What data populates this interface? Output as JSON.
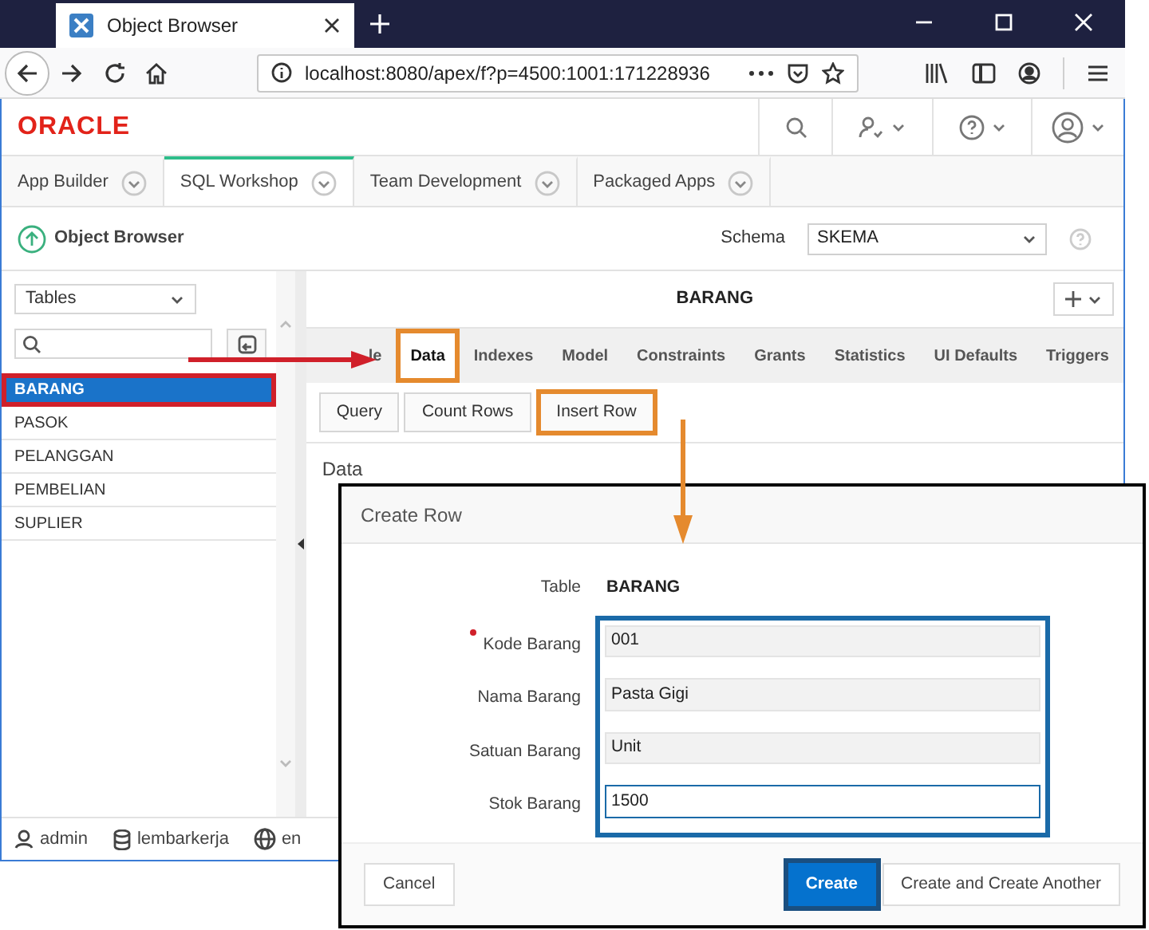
{
  "browser": {
    "tab_title": "Object Browser",
    "url": "localhost:8080/apex/f?p=4500:1001:171228936"
  },
  "app": {
    "logo": "ORACLE",
    "tabs": [
      {
        "label": "App Builder",
        "selected": false
      },
      {
        "label": "SQL Workshop",
        "selected": true
      },
      {
        "label": "Team Development",
        "selected": false
      },
      {
        "label": "Packaged Apps",
        "selected": false
      }
    ]
  },
  "page": {
    "title": "Object Browser",
    "schema_label": "Schema",
    "schema_value": "SKEMA"
  },
  "sidebar": {
    "filter": "Tables",
    "items": [
      {
        "label": "BARANG",
        "selected": true,
        "highlighted": true
      },
      {
        "label": "PASOK",
        "selected": false,
        "highlighted": false
      },
      {
        "label": "PELANGGAN",
        "selected": false,
        "highlighted": false
      },
      {
        "label": "PEMBELIAN",
        "selected": false,
        "highlighted": false
      },
      {
        "label": "SUPLIER",
        "selected": false,
        "highlighted": false
      }
    ]
  },
  "object": {
    "name": "BARANG",
    "tabs": [
      {
        "label": "le",
        "selected": false,
        "highlighted": false
      },
      {
        "label": "Data",
        "selected": true,
        "highlighted": true
      },
      {
        "label": "Indexes",
        "selected": false,
        "highlighted": false
      },
      {
        "label": "Model",
        "selected": false,
        "highlighted": false
      },
      {
        "label": "Constraints",
        "selected": false,
        "highlighted": false
      },
      {
        "label": "Grants",
        "selected": false,
        "highlighted": false
      },
      {
        "label": "Statistics",
        "selected": false,
        "highlighted": false
      },
      {
        "label": "UI Defaults",
        "selected": false,
        "highlighted": false
      },
      {
        "label": "Triggers",
        "selected": false,
        "highlighted": false
      }
    ],
    "actions": [
      {
        "label": "Query",
        "highlighted": false
      },
      {
        "label": "Count Rows",
        "highlighted": false
      },
      {
        "label": "Insert Row",
        "highlighted": true
      }
    ],
    "section": "Data"
  },
  "footer": {
    "user": "admin",
    "workspace": "lembarkerja",
    "language": "en"
  },
  "dialog": {
    "title": "Create Row",
    "table_label": "Table",
    "table_value": "BARANG",
    "fields_highlighted": true,
    "fields": [
      {
        "label": "Kode Barang",
        "value": "001",
        "required": true,
        "focused": false
      },
      {
        "label": "Nama Barang",
        "value": "Pasta Gigi",
        "required": false,
        "focused": false
      },
      {
        "label": "Satuan Barang",
        "value": "Unit",
        "required": false,
        "focused": false
      },
      {
        "label": "Stok Barang",
        "value": "1500",
        "required": false,
        "focused": true
      }
    ],
    "buttons": [
      {
        "label": "Cancel",
        "kind": "secondary",
        "highlighted": false
      },
      {
        "label": "Create",
        "kind": "primary",
        "highlighted": true
      },
      {
        "label": "Create and Create Another",
        "kind": "secondary",
        "highlighted": false
      }
    ]
  }
}
